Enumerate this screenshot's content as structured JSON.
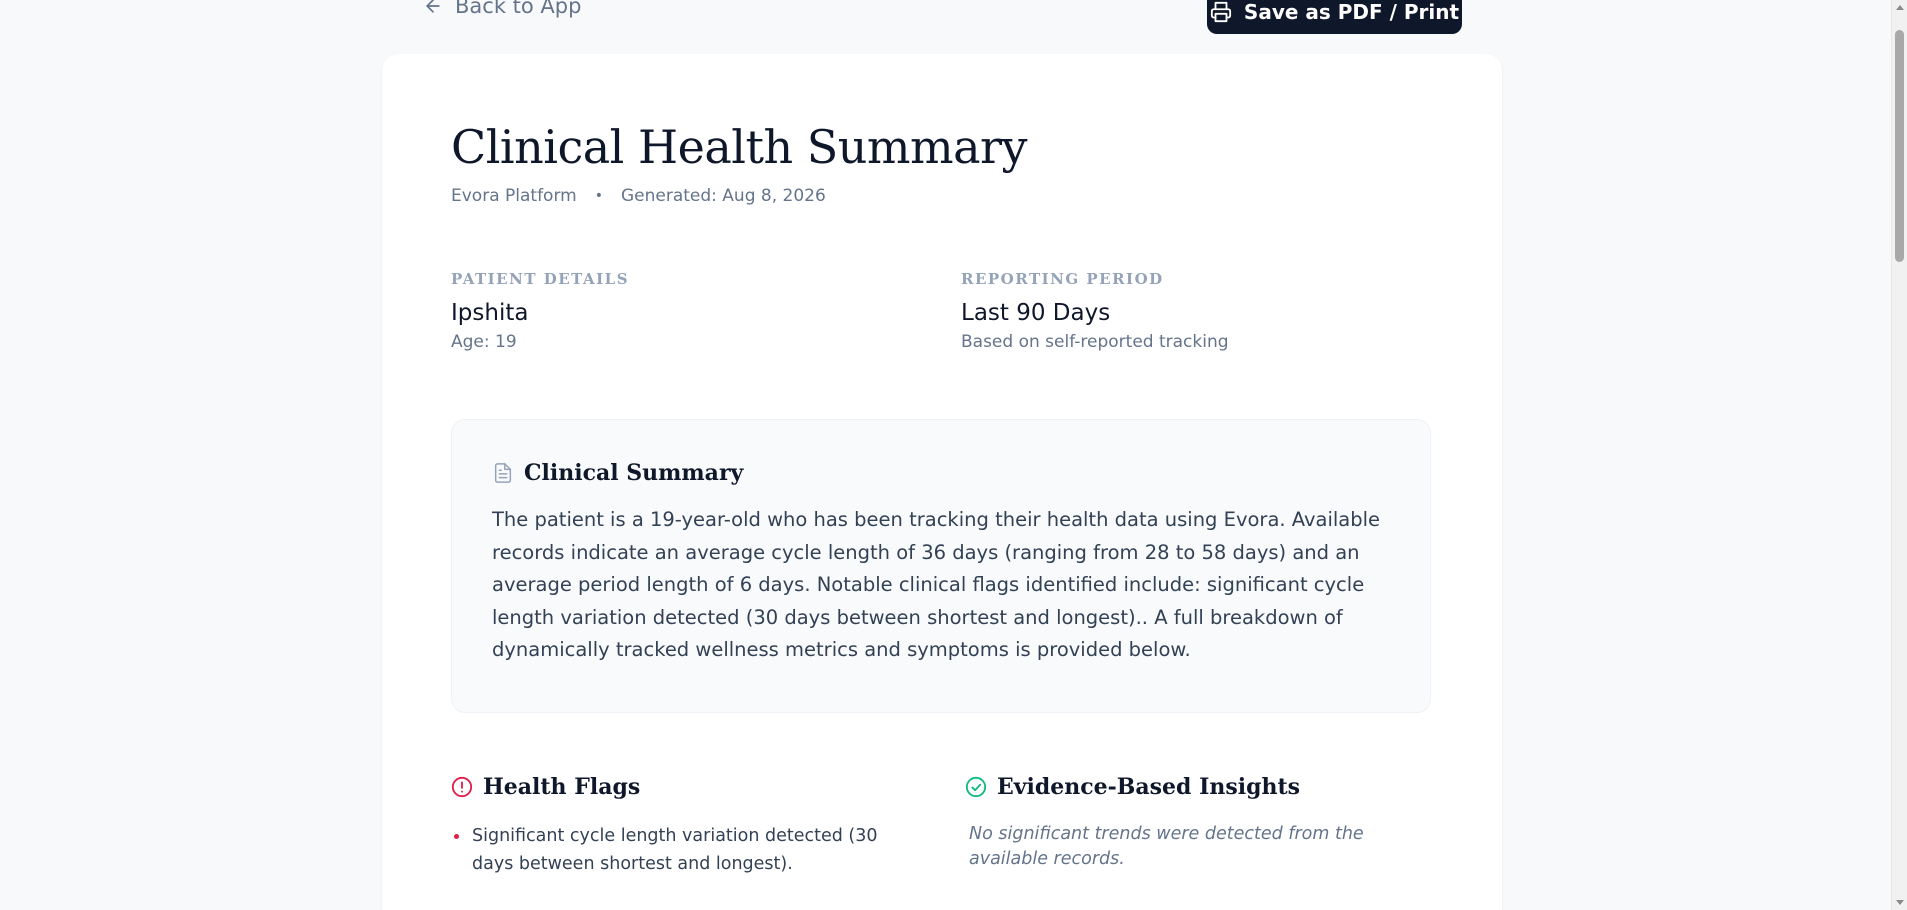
{
  "nav": {
    "back_label": "Back to App",
    "print_label": "Save as PDF / Print"
  },
  "report": {
    "title": "Clinical Health Summary",
    "platform": "Evora Platform",
    "separator": "•",
    "generated": "Generated: Aug 8, 2026"
  },
  "patient": {
    "label": "PATIENT DETAILS",
    "name": "Ipshita",
    "age": "Age: 19"
  },
  "period": {
    "label": "REPORTING PERIOD",
    "value": "Last 90 Days",
    "note": "Based on self-reported tracking"
  },
  "summary": {
    "heading": "Clinical Summary",
    "text": "The patient is a 19-year-old who has been tracking their health data using Evora. Available records indicate an average cycle length of 36 days (ranging from 28 to 58 days) and an average period length of 6 days. Notable clinical flags identified include: significant cycle length variation detected (30 days between shortest and longest).. A full breakdown of dynamically tracked wellness metrics and symptoms is provided below."
  },
  "flags": {
    "heading": "Health Flags",
    "items": [
      "Significant cycle length variation detected (30 days between shortest and longest)."
    ]
  },
  "insights": {
    "heading": "Evidence-Based Insights",
    "empty_text": "No significant trends were detected from the available records."
  },
  "colors": {
    "primary_dark": "#0f172a",
    "flag_red": "#e11d48",
    "insight_green": "#10b981",
    "muted": "#64748b"
  },
  "icons": {
    "back": "arrow-left-icon",
    "print": "printer-icon",
    "summary": "document-icon",
    "flags": "alert-circle-icon",
    "insights": "check-circle-icon"
  }
}
